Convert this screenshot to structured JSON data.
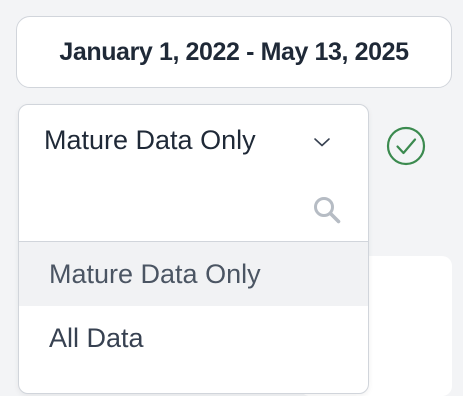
{
  "date_filter": {
    "label": "January 1, 2022 - May 13, 2025"
  },
  "data_select": {
    "selected_value": "Mature Data Only",
    "search": {
      "value": "",
      "placeholder": ""
    },
    "options": [
      {
        "label": "Mature Data Only",
        "highlighted": true
      },
      {
        "label": "All Data",
        "highlighted": false
      }
    ]
  },
  "icons": {
    "chevron": "chevron-down-icon",
    "search": "search-icon",
    "confirm": "check-circle-icon"
  },
  "colors": {
    "confirm_green": "#3b8a4f",
    "border": "#d1d5db",
    "highlight": "#f1f2f4",
    "icon_gray": "#b6bcc4"
  }
}
